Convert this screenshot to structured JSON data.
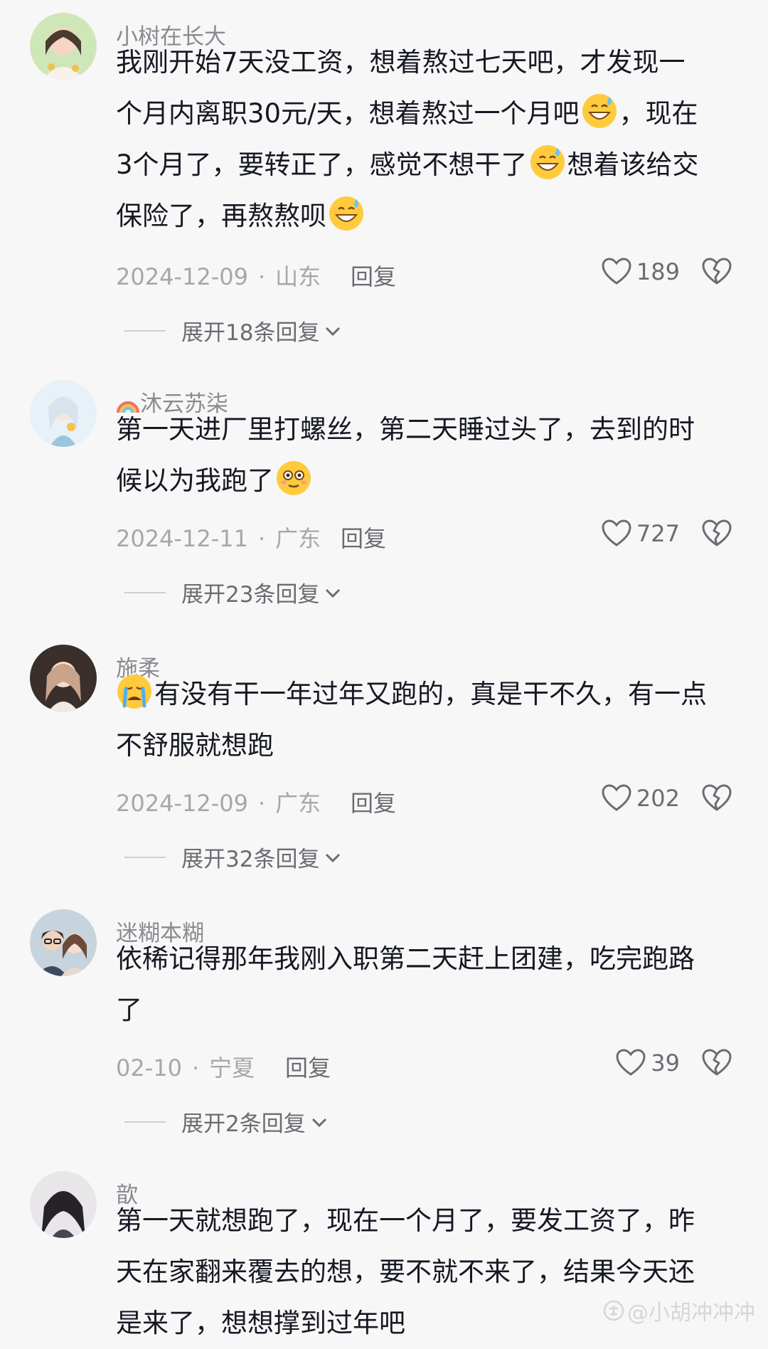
{
  "colors": {
    "background": "#f7f7f7",
    "text_primary": "#161823",
    "text_secondary": "#8a8b91",
    "meta": "#a6a7ab",
    "action": "#6b6c72"
  },
  "comments": [
    {
      "username": "小树在长大",
      "text_lines": [
        "我刚开始7天没工资，想着熬过七天吧，才发现一",
        "个月内离职30元/天，想着熬过一个月吧",
        "，现在",
        "3个月了，要转正了，感觉不想干了",
        "想着该给交",
        "保险了，再熬熬呗"
      ],
      "date": "2024-12-09",
      "location": "山东",
      "reply_label": "回复",
      "likes": "189",
      "expand_label": "展开18条回复"
    },
    {
      "username_prefix_icon": "rainbow-icon",
      "username": "沐云苏柒",
      "text_lines": [
        "第一天进厂里打螺丝，第二天睡过头了，去到的时",
        "候以为我跑了"
      ],
      "date": "2024-12-11",
      "location": "广东",
      "reply_label": "回复",
      "likes": "727",
      "expand_label": "展开23条回复"
    },
    {
      "username": "施柔",
      "text_lines": [
        "有没有干一年过年又跑的，真是干不久，有一点",
        "不舒服就想跑"
      ],
      "date": "2024-12-09",
      "location": "广东",
      "reply_label": "回复",
      "likes": "202",
      "expand_label": "展开32条回复"
    },
    {
      "username": "迷糊本糊",
      "text_lines": [
        "依稀记得那年我刚入职第二天赶上团建，吃完跑路",
        "了"
      ],
      "date": "02-10",
      "location": "宁夏",
      "reply_label": "回复",
      "likes": "39",
      "expand_label": "展开2条回复"
    },
    {
      "username": "歆",
      "text_lines": [
        "第一天就想跑了，现在一个月了，要发工资了，昨",
        "天在家翻来覆去的想，要不就不来了，结果今天还",
        "是来了，想想撑到过年吧"
      ]
    }
  ],
  "watermark": "头条 @小胡冲冲冲",
  "watermark_text": "@小胡冲冲冲",
  "separator": "·"
}
